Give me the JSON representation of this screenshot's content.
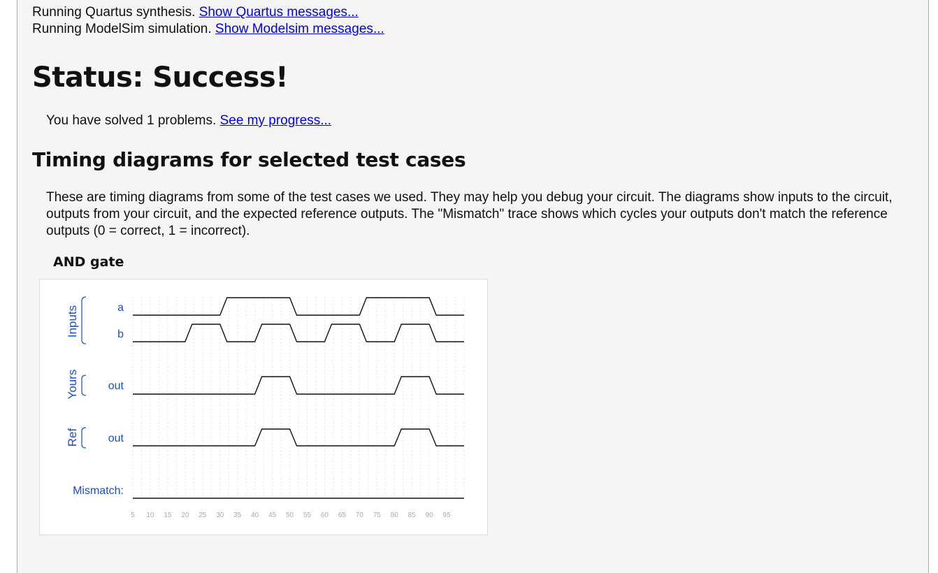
{
  "log": {
    "quartus_text": "Running Quartus synthesis.",
    "quartus_link": "Show Quartus messages...",
    "modelsim_text": "Running ModelSim simulation.",
    "modelsim_link": "Show Modelsim messages..."
  },
  "status": {
    "title": "Status: Success!"
  },
  "progress": {
    "text": "You have solved 1 problems.",
    "link": "See my progress..."
  },
  "timing": {
    "heading": "Timing diagrams for selected test cases",
    "description": "These are timing diagrams from some of the test cases we used. They may help you debug your circuit. The diagrams show inputs to the circuit, outputs from your circuit, and the expected reference outputs. The \"Mismatch\" trace shows which cycles your outputs don't match the reference outputs (0 = correct, 1 = incorrect).",
    "diagram_title": "AND gate",
    "groups": {
      "inputs": "Inputs",
      "yours": "Yours",
      "ref": "Ref"
    },
    "mismatch_label": "Mismatch:",
    "colors": {
      "label": "#1a4fc9",
      "trace": "#111111",
      "tick": "#aaaaaa"
    },
    "time_range": [
      5,
      100
    ],
    "ticks": [
      5,
      10,
      15,
      20,
      25,
      30,
      35,
      40,
      45,
      50,
      55,
      60,
      65,
      70,
      75,
      80,
      85,
      90,
      95
    ],
    "signals": [
      {
        "name": "a",
        "group": "inputs",
        "initial": 0,
        "toggles": [
          30,
          50,
          70,
          90
        ]
      },
      {
        "name": "b",
        "group": "inputs",
        "initial": 0,
        "toggles": [
          20,
          30,
          40,
          50,
          60,
          70,
          80,
          90
        ]
      },
      {
        "name": "out",
        "group": "yours",
        "initial": 0,
        "toggles": [
          40,
          50,
          80,
          90
        ]
      },
      {
        "name": "out",
        "group": "ref",
        "initial": 0,
        "toggles": [
          40,
          50,
          80,
          90
        ]
      },
      {
        "name": "Mismatch:",
        "group": "mismatch",
        "initial": 0,
        "toggles": []
      }
    ]
  }
}
